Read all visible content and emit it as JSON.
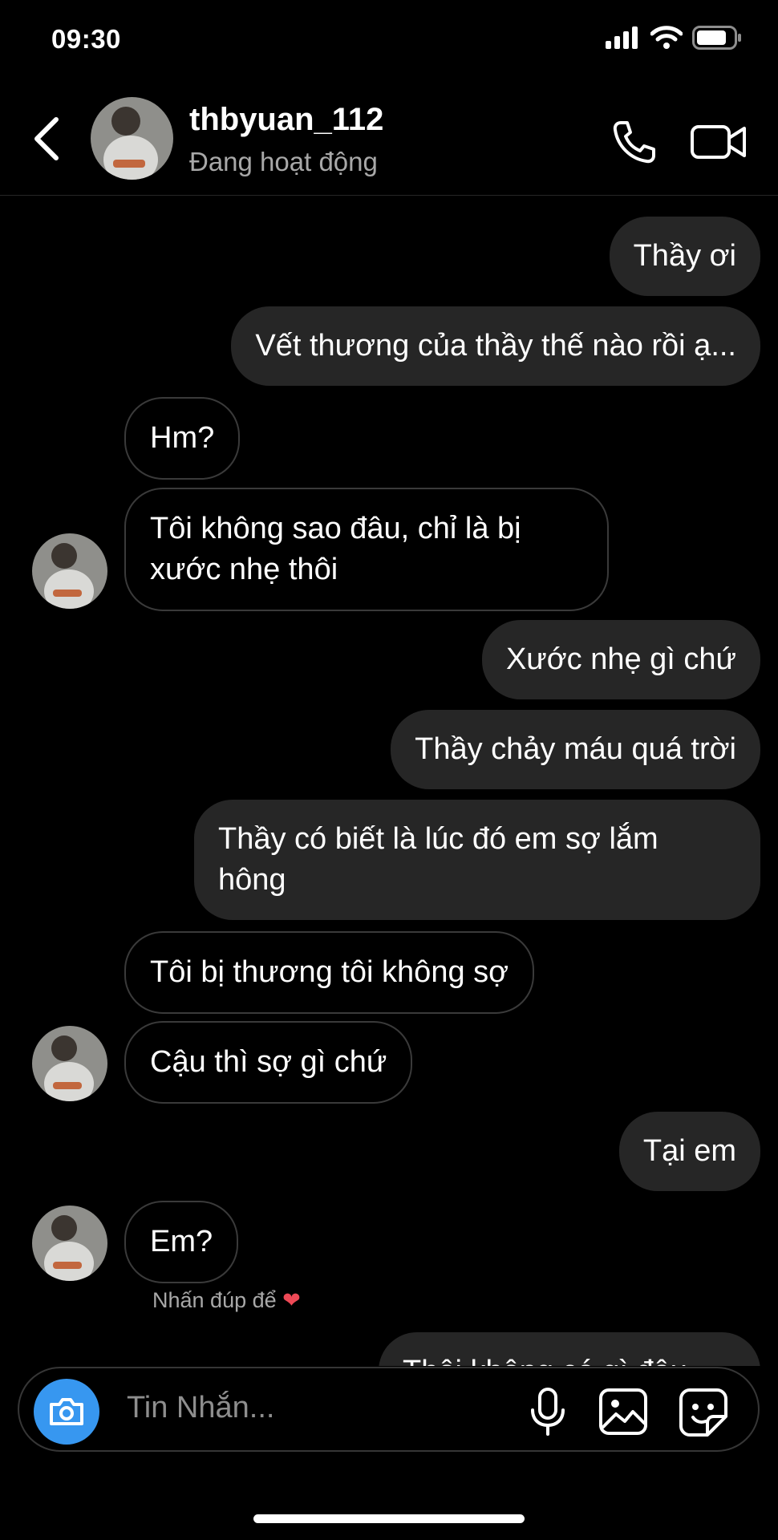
{
  "status_bar": {
    "time": "09:30"
  },
  "header": {
    "username": "thbyuan_112",
    "presence": "Đang hoạt động"
  },
  "messages": [
    {
      "side": "sent",
      "text": "Thầy ơi"
    },
    {
      "side": "sent",
      "text": "Vết thương của thầy thế nào rồi ạ..."
    },
    {
      "side": "recv",
      "text": "Hm?"
    },
    {
      "side": "recv",
      "text": "Tôi không sao đâu, chỉ là bị\nxước nhẹ thôi"
    },
    {
      "side": "sent",
      "text": "Xước nhẹ gì chứ"
    },
    {
      "side": "sent",
      "text": "Thầy chảy máu quá trời"
    },
    {
      "side": "sent",
      "text": "Thầy có biết là lúc đó em sợ lắm\nhông"
    },
    {
      "side": "recv",
      "text": "Tôi bị thương tôi không sợ"
    },
    {
      "side": "recv",
      "text": "Cậu thì sợ gì chứ"
    },
    {
      "side": "sent",
      "text": "Tại em"
    },
    {
      "side": "recv",
      "text": "Em?"
    },
    {
      "side": "sent",
      "text": "Thôi không có gì đâu"
    }
  ],
  "double_tap_hint": {
    "text": "Nhấn đúp để",
    "icon": "heart-icon"
  },
  "composer": {
    "placeholder": "Tin Nhắn..."
  },
  "colors": {
    "background": "#000000",
    "sent_bubble": "#262626",
    "accent": "#3797f0",
    "heart": "#ed4956"
  }
}
